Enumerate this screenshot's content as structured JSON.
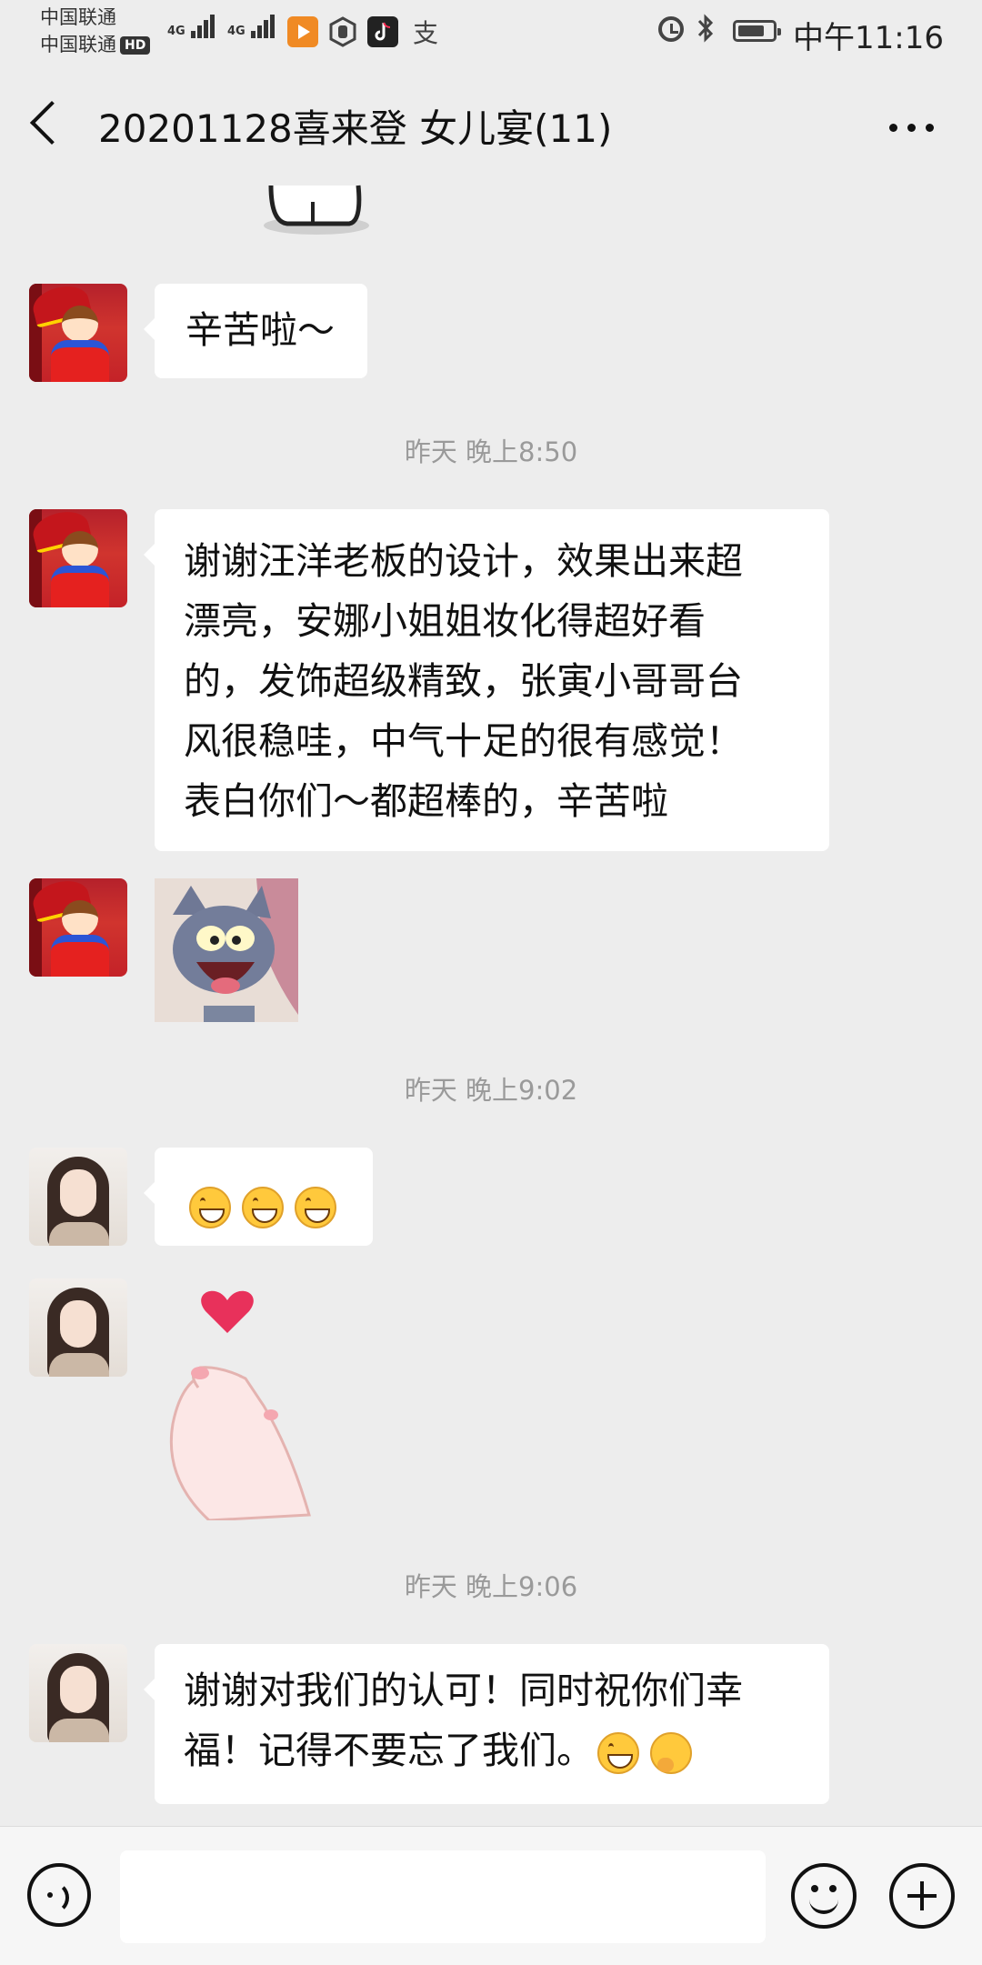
{
  "status_bar": {
    "carrier_1": "中国联通",
    "carrier_2": "中国联通",
    "hd_badge": "HD",
    "network_1": "4G",
    "network_2": "4G",
    "time": "中午11:16",
    "app_icons": [
      "video-app-icon",
      "hand-app-icon",
      "tiktok-icon",
      "alipay-icon"
    ],
    "status_icons": [
      "alarm-icon",
      "bluetooth-icon",
      "battery-icon"
    ]
  },
  "header": {
    "title": "20201128喜来登  女儿宴(11)",
    "back_icon": "chevron-left-icon",
    "more_icon": "more-dots-icon"
  },
  "messages": [
    {
      "sender": "A",
      "type": "sticker-partial",
      "sticker": "cartoon-cat-sticker"
    },
    {
      "sender": "A",
      "type": "text",
      "text": "辛苦啦～"
    },
    {
      "type": "timestamp",
      "text": "昨天 晚上8:50"
    },
    {
      "sender": "A",
      "type": "text",
      "text": "谢谢汪洋老板的设计，效果出来超\n漂亮，安娜小姐姐妆化得超好看\n的，发饰超级精致，张寅小哥哥台\n风很稳哇，中气十足的很有感觉！\n表白你们～都超棒的，辛苦啦"
    },
    {
      "sender": "A",
      "type": "sticker",
      "sticker": "tom-cat-laughing-sticker"
    },
    {
      "type": "timestamp",
      "text": "昨天 晚上9:02"
    },
    {
      "sender": "B",
      "type": "emoji",
      "emojis": [
        "grin-emoji",
        "grin-emoji",
        "grin-emoji"
      ]
    },
    {
      "sender": "B",
      "type": "sticker",
      "sticker": "finger-heart-sticker"
    },
    {
      "type": "timestamp",
      "text": "昨天 晚上9:06"
    },
    {
      "sender": "B",
      "type": "text",
      "text": "谢谢对我们的认可！同时祝你们幸\n福！记得不要忘了我们。",
      "trailing_emojis": [
        "grin-emoji",
        "thinking-emoji"
      ]
    }
  ],
  "input_bar": {
    "voice_icon": "voice-icon",
    "input_value": "",
    "emoji_icon": "emoji-icon",
    "plus_icon": "plus-icon"
  },
  "colors": {
    "background": "#ededed",
    "bubble": "#ffffff",
    "timestamp_text": "#9a9a9a",
    "heart": "#e8315b"
  }
}
